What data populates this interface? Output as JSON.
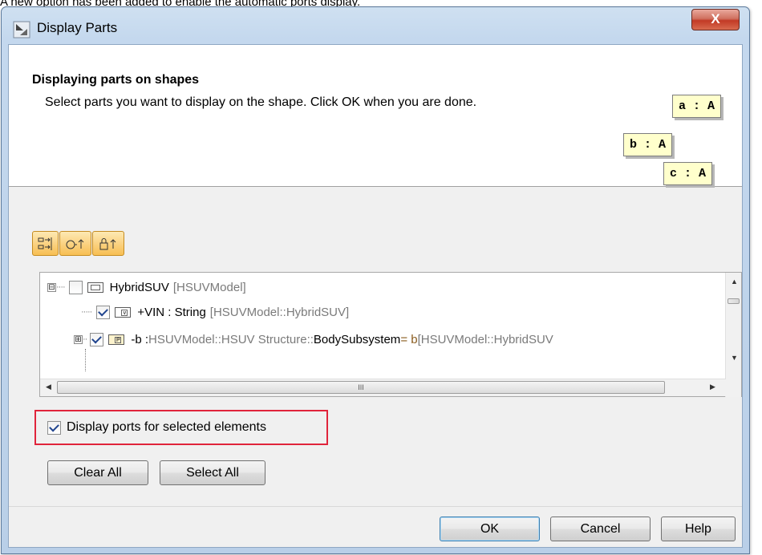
{
  "caption": "A new option has been added to enable the automatic ports display.",
  "window": {
    "title": "Display Parts",
    "close_label": "X"
  },
  "header": {
    "title": "Displaying parts on shapes",
    "description": "Select parts you want to display on the shape. Click OK when you are done.",
    "illustration": [
      "a : A",
      "b : A",
      "c : A"
    ]
  },
  "toolbar": {
    "buttons": [
      "display-parts",
      "show-inherited",
      "show-private"
    ]
  },
  "tree": {
    "rows": [
      {
        "expander": "⊟",
        "checked": false,
        "name": "HybridSUV",
        "owner": "[HSUVModel]"
      },
      {
        "expander": "",
        "checked": true,
        "name": "+VIN : String",
        "owner": "[HSUVModel::HybridSUV]"
      },
      {
        "expander": "⊞",
        "checked": true,
        "name": "-b : ",
        "type": "HSUVModel::HSUV Structure::",
        "type_name": "BodySubsystem",
        "value": " = b",
        "owner": " [HSUVModel::HybridSUV"
      }
    ],
    "hscroll_grip": "III"
  },
  "ports_option": {
    "checked": true,
    "label": "Display ports for selected elements"
  },
  "actions": {
    "clear_all": "Clear All",
    "select_all": "Select All"
  },
  "dialog_buttons": {
    "ok": "OK",
    "cancel": "Cancel",
    "help": "Help"
  }
}
